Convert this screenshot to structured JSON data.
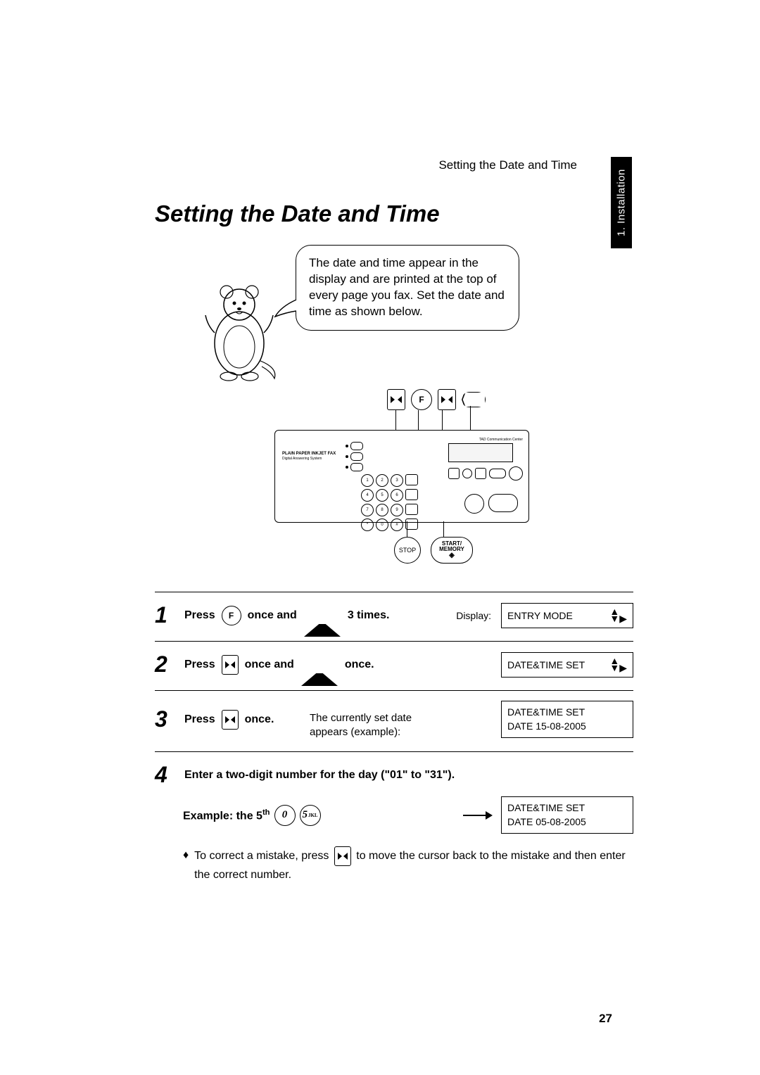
{
  "header": {
    "section_title": "Setting the Date and Time",
    "side_tab": "1. Installation"
  },
  "title": "Setting the Date and Time",
  "speech_bubble": "The date and time appear in the display and are printed at the top of every page you fax. Set the date and time as shown below.",
  "device": {
    "model_line1": "PLAIN PAPER INKJET FAX",
    "model_line2": "Digital Answering System",
    "stop_label": "STOP",
    "start_label_1": "START/",
    "start_label_2": "MEMORY",
    "f_key": "F"
  },
  "steps": {
    "s1": {
      "num": "1",
      "press": "Press",
      "f": "F",
      "once_and": "once and",
      "three_times": "3 times.",
      "display_label": "Display:",
      "lcd": "ENTRY MODE"
    },
    "s2": {
      "num": "2",
      "press": "Press",
      "once_and": "once and",
      "once": "once.",
      "lcd": "DATE&TIME SET"
    },
    "s3": {
      "num": "3",
      "press": "Press",
      "once": "once.",
      "note": "The currently set date appears (example):",
      "lcd_line1": "DATE&TIME SET",
      "lcd_line2": "DATE 15-08-2005"
    },
    "s4": {
      "num": "4",
      "instruction": "Enter a two-digit number for the day (\"01\" to \"31\").",
      "example_prefix": "Example: the 5",
      "example_sup": "th",
      "key0": "0",
      "key5": "5",
      "lcd_line1": "DATE&TIME SET",
      "lcd_line2": "DATE 05-08-2005",
      "bullet_pre": "To correct a mistake, press",
      "bullet_post": "to move the cursor back to the mistake and then enter the correct number."
    }
  },
  "page_number": "27"
}
